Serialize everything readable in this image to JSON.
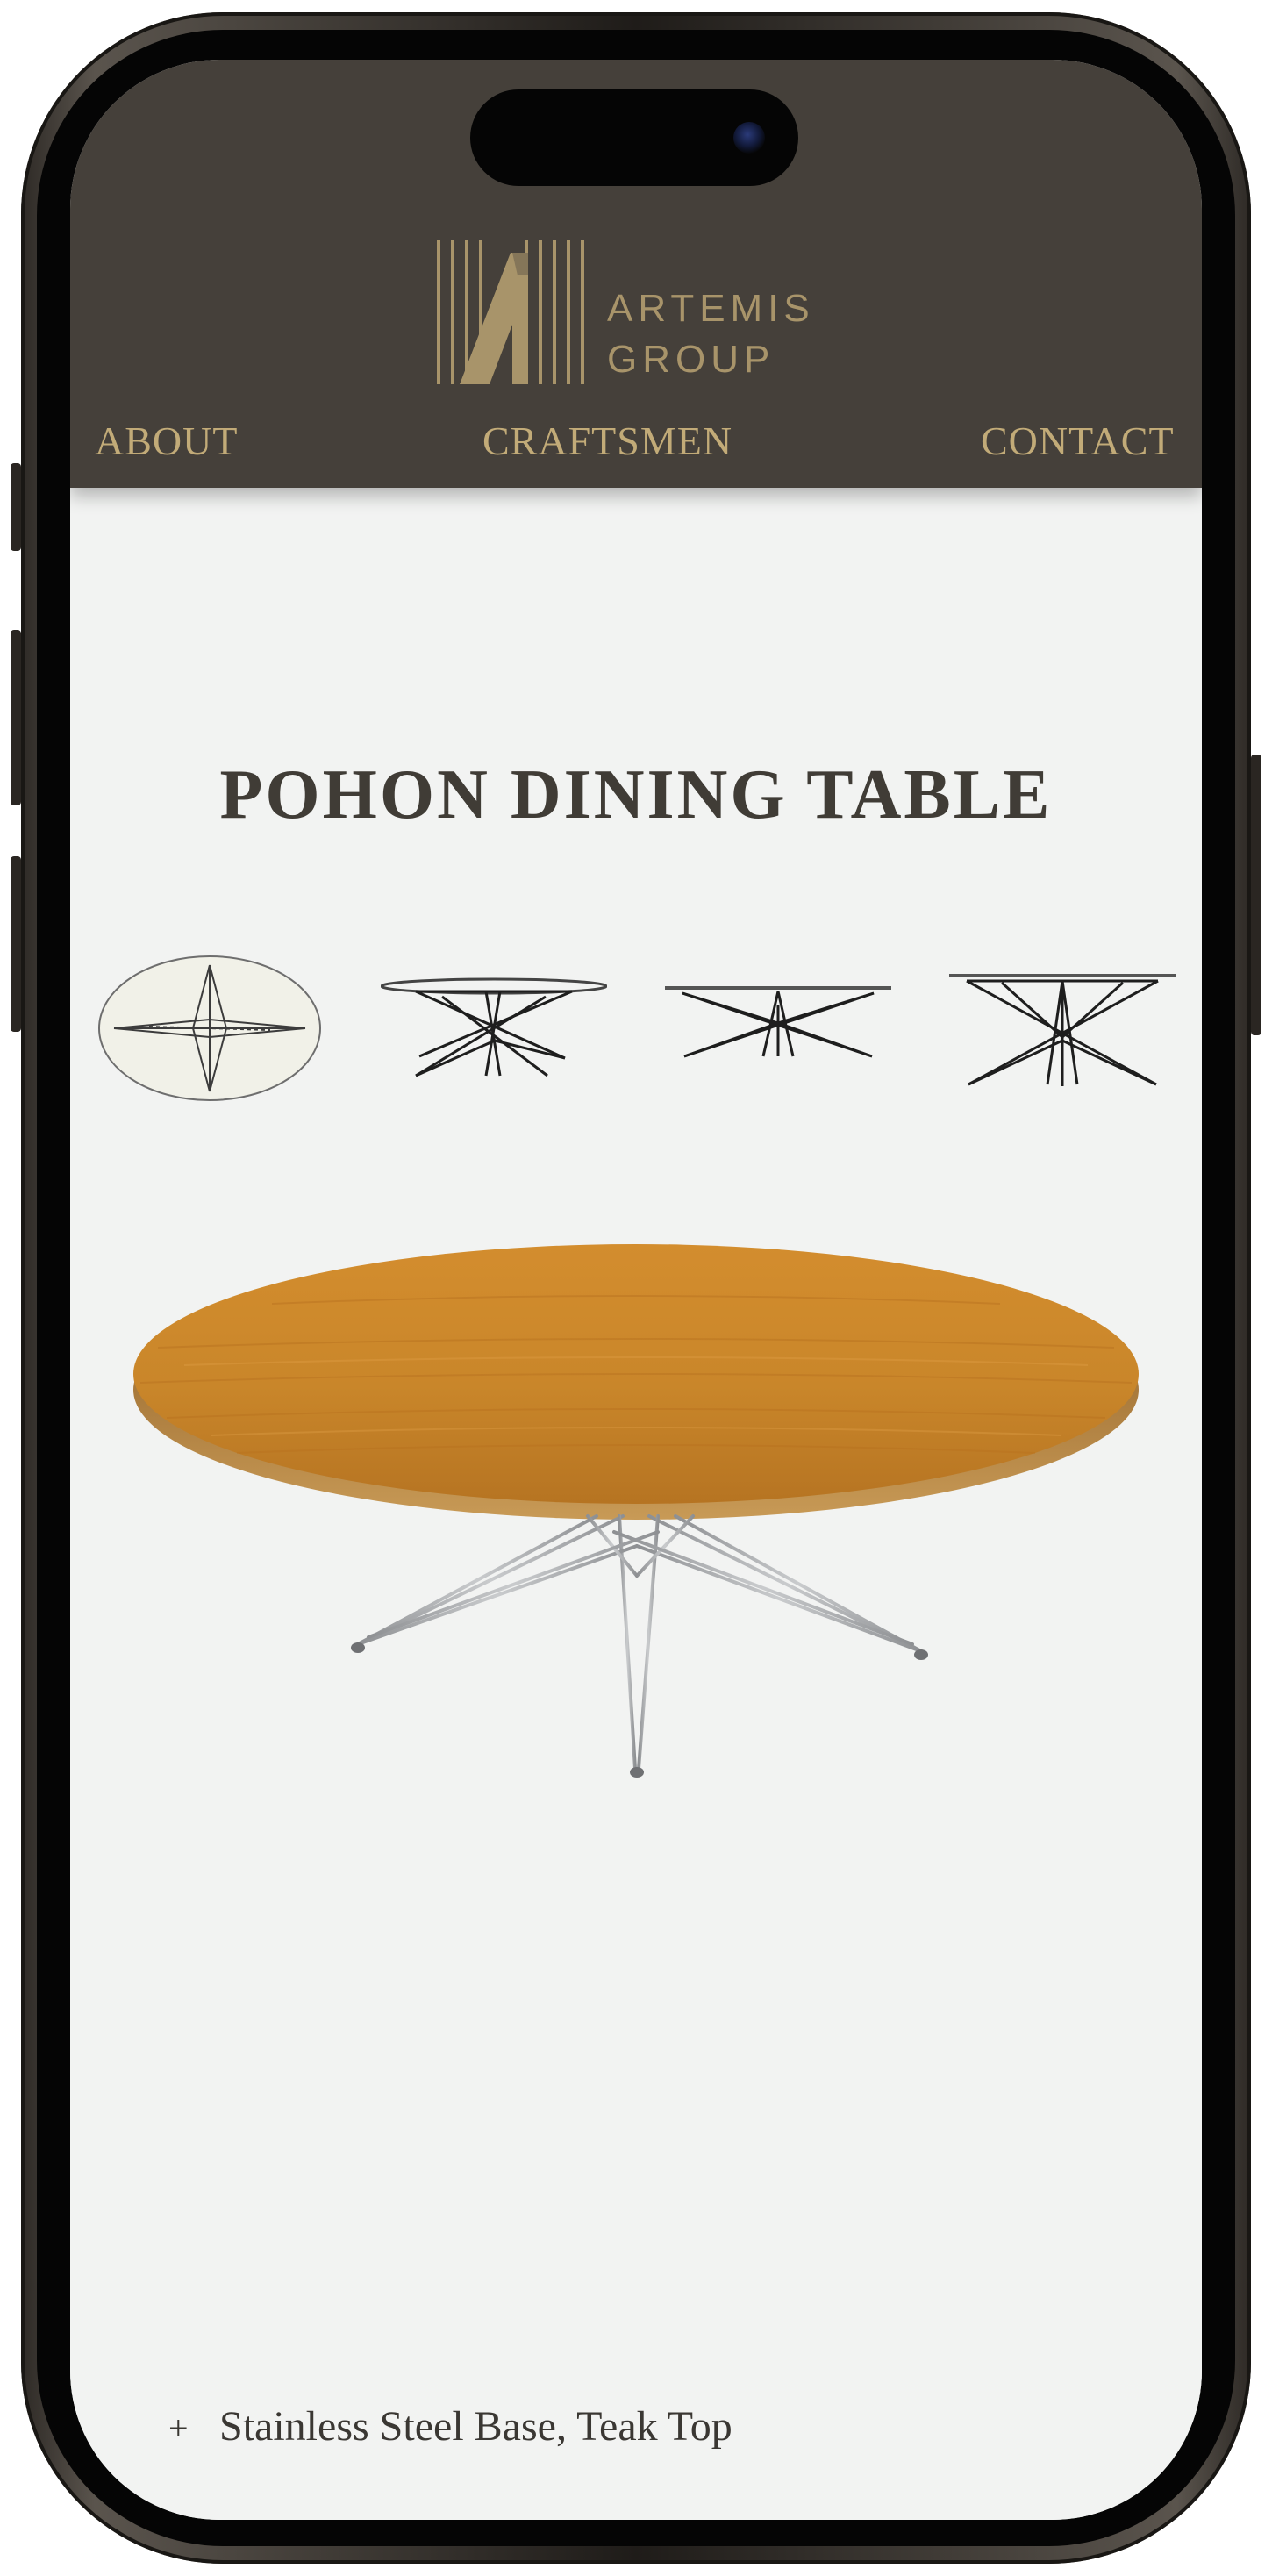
{
  "brand": {
    "name_line1": "ARTEMIS",
    "name_line2": "GROUP",
    "color": "#a8946a",
    "header_bg": "#45403a"
  },
  "nav": {
    "items": [
      {
        "label": "ABOUT"
      },
      {
        "label": "CRAFTSMEN"
      },
      {
        "label": "CONTACT"
      }
    ],
    "color": "#c2ab78"
  },
  "product": {
    "title": "POHON DINING TABLE",
    "thumbnails": [
      {
        "view": "top-view"
      },
      {
        "view": "angle-view"
      },
      {
        "view": "side-view"
      },
      {
        "view": "front-view"
      }
    ],
    "spec_marker": "+",
    "spec_text": "Stainless Steel Base, Teak Top"
  },
  "colors": {
    "page_bg": "#f2f3f2",
    "title": "#403c36",
    "teak": "#c9862a",
    "steel": "#a7a9ab"
  }
}
